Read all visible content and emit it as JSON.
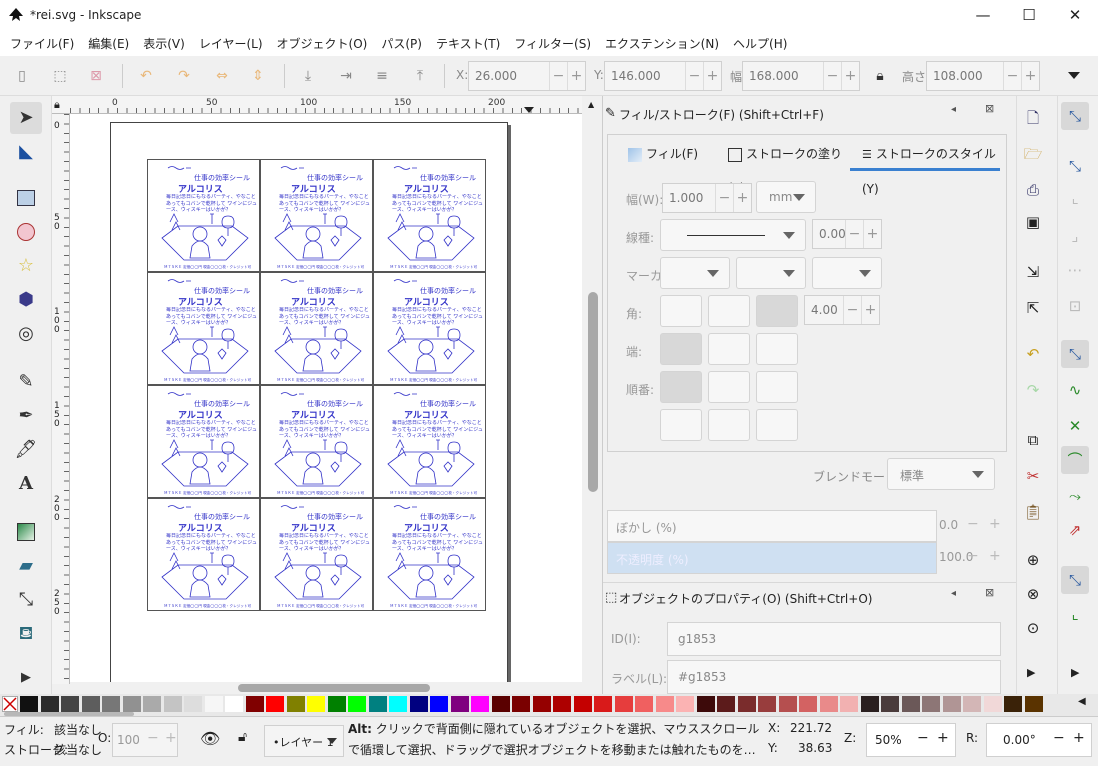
{
  "window": {
    "title": "*rei.svg - Inkscape",
    "minimize": "—",
    "maximize": "☐",
    "close": "✕"
  },
  "menu": [
    "ファイル(F)",
    "編集(E)",
    "表示(V)",
    "レイヤー(L)",
    "オブジェクト(O)",
    "パス(P)",
    "テキスト(T)",
    "フィルター(S)",
    "エクステンション(N)",
    "ヘルプ(H)"
  ],
  "coords": {
    "x_label": "X:",
    "x_value": "26.000",
    "y_label": "Y:",
    "y_value": "146.000",
    "w_label": "幅:",
    "w_value": "168.000",
    "h_label": "高さ:",
    "h_value": "108.000"
  },
  "rulers": {
    "top": [
      "0",
      "50",
      "100",
      "150",
      "200"
    ],
    "left": [
      "0",
      "5\n0",
      "1\n0\n0",
      "1\n5\n0",
      "2\n0\n0",
      "2\n5\n0"
    ]
  },
  "sticker": {
    "tagline": "仕事の効率シール",
    "name": "アルコリス",
    "body": "毎日記念日にもなるパーティ、やなことあってもコバンで乾杯して ワインにジュース、ウィスキーはいかが？",
    "footer": "Ｍ７ＳＫＥ 定価◯◯円 現金◯◯◯枚・クレジット可"
  },
  "fill_stroke": {
    "panel_title": "フィル/ストローク(F) (Shift+Ctrl+F)",
    "tabs": [
      "フィル(F)",
      "ストロークの塗り(P)",
      "ストロークのスタイル(Y)"
    ],
    "width_label": "幅(W):",
    "width_value": "1.000",
    "width_unit": "mm",
    "dash_label": "線種:",
    "dash_value": "0.00",
    "marker_label": "マーカー:",
    "join_label": "角:",
    "join_value": "4.00",
    "cap_label": "端:",
    "order_label": "順番:",
    "blend_label": "ブレンドモード:",
    "blend_value": "標準",
    "blur_label": "ぼかし (%)",
    "blur_value": "0.0",
    "opacity_label": "不透明度 (%)",
    "opacity_value": "100.0"
  },
  "object_props": {
    "panel_title": "オブジェクトのプロパティ(O) (Shift+Ctrl+O)",
    "id_label": "ID(I):",
    "id_value": "g1853",
    "label_label": "ラベル(L):",
    "label_value": "#g1853"
  },
  "status": {
    "fill_label": "フィル:",
    "fill_value": "該当なし",
    "stroke_label": "ストローク:",
    "stroke_value": "該当なし",
    "opacity_label": "O:",
    "opacity_value": "100",
    "layer": "•レイヤー 1",
    "msg_bold": "Alt:",
    "msg": " クリックで背面側に隠れているオブジェクトを選択、マウススクロールで循環して選択、ドラッグで選択オブジェクトを移動または触れたものを…",
    "x_label": "X:",
    "x_value": "221.72",
    "y_label": "Y:",
    "y_value": "38.63",
    "zoom_label": "Z:",
    "zoom_value": "50%",
    "rot_label": "R:",
    "rot_value": "0.00°"
  },
  "palette": [
    "#111111",
    "#2b2b2b",
    "#444444",
    "#5d5d5d",
    "#777777",
    "#919191",
    "#aaaaaa",
    "#c4c4c4",
    "#dddddd",
    "#f6f6f6",
    "#ffffff",
    "#800000",
    "#ff0000",
    "#808000",
    "#ffff00",
    "#008000",
    "#00ff00",
    "#008080",
    "#00ffff",
    "#000080",
    "#0000ff",
    "#800080",
    "#ff00ff",
    "#5a0000",
    "#7a0000",
    "#950000",
    "#ad0000",
    "#c40000",
    "#d91a1a",
    "#e63d3d",
    "#f06060",
    "#f78a8a",
    "#fbb3b3",
    "#3d0a0a",
    "#5c1b1b",
    "#7a2c2c",
    "#983d3d",
    "#b54f4f",
    "#d36262",
    "#e98a8a",
    "#f2b1b1",
    "#2a1f1f",
    "#4a3b3b",
    "#6b5858",
    "#8d7676",
    "#b09595",
    "#d3b6b6",
    "#f1d8d8",
    "#3a2208",
    "#5a3300"
  ]
}
